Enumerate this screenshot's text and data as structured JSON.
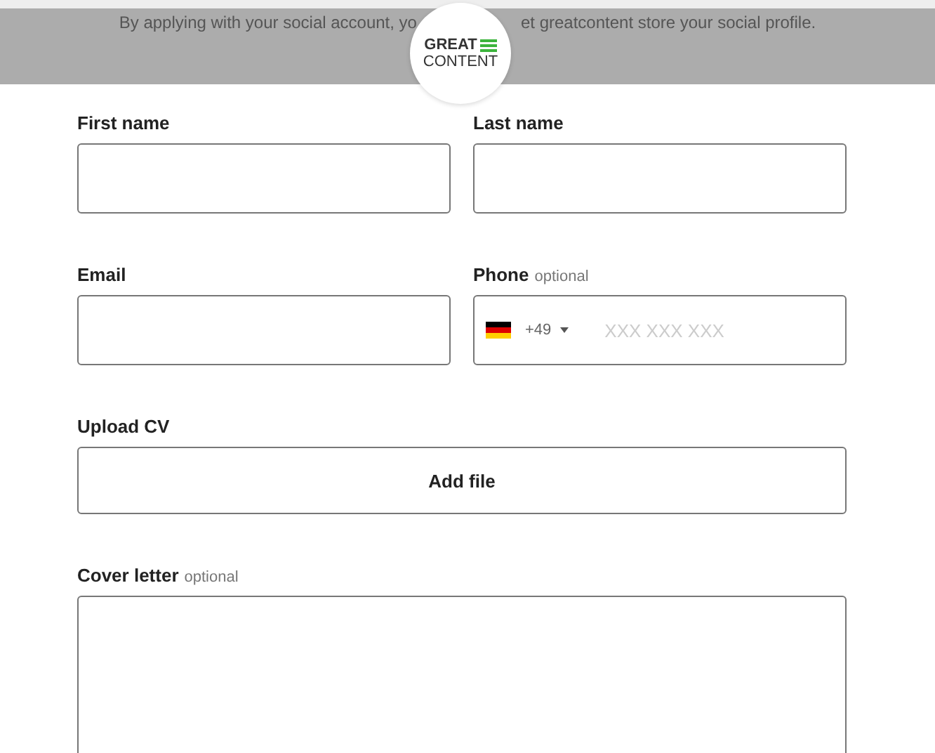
{
  "banner": {
    "text_before": "By applying with your social account, yo",
    "text_after": "et greatcontent store your social profile.",
    "logo": {
      "line_1": "GREAT",
      "line_2": "CONTENT"
    }
  },
  "fields": [
    {
      "kind": "text",
      "label": "First name"
    },
    {
      "kind": "text",
      "label": "Last name"
    },
    {
      "kind": "text",
      "label": "Email"
    },
    {
      "kind": "phone",
      "label": "Phone",
      "note": "optional",
      "code": "+49",
      "placeholder": "XXX XXX XXX"
    },
    {
      "kind": "file",
      "label": "Upload CV",
      "button": "Add file"
    },
    {
      "kind": "textarea",
      "label": "Cover letter",
      "note": "optional"
    }
  ]
}
